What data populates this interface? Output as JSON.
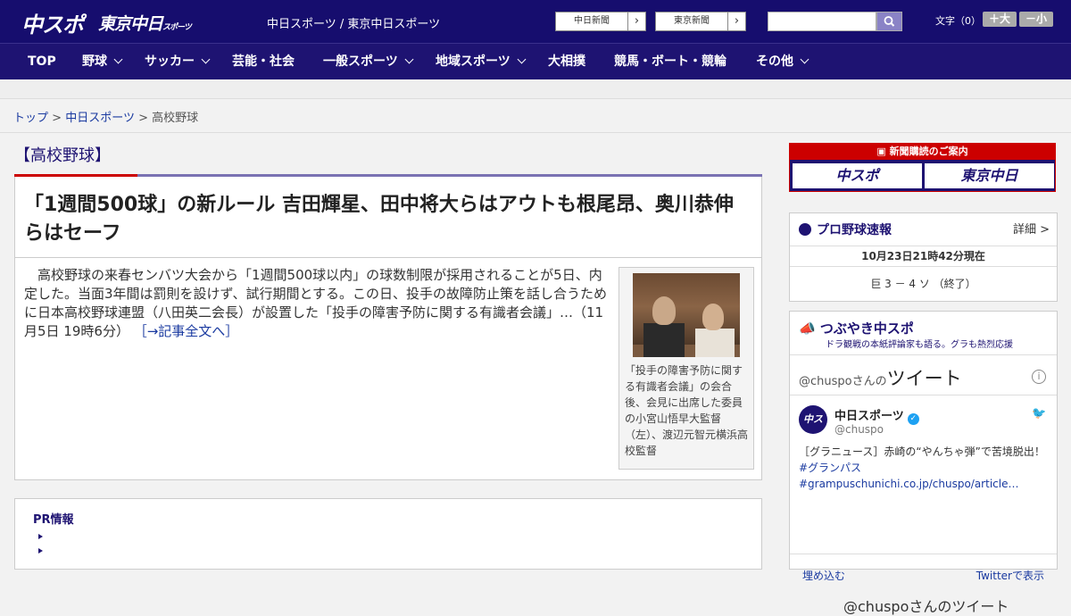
{
  "header": {
    "logo_chuspo": "中スポ",
    "logo_tokyo": "東京中日",
    "logo_tokyo_small": "スポーツ",
    "site_title": "中日スポーツ / 東京中日スポーツ",
    "paper_links": [
      {
        "label": "中日新聞"
      },
      {
        "label": "東京新聞"
      }
    ],
    "search": {
      "value": "",
      "placeholder": ""
    },
    "font_size_label": "文字（0）",
    "font_bigger": "＋大",
    "font_smaller": "－小",
    "colors": {
      "header_bg": "#160d6e",
      "accent_red": "#cc0000"
    }
  },
  "nav": {
    "items": [
      {
        "label": "TOP"
      },
      {
        "label": "野球"
      },
      {
        "label": "サッカー"
      },
      {
        "label": "芸能・社会"
      },
      {
        "label": "一般スポーツ"
      },
      {
        "label": "地域スポーツ"
      },
      {
        "label": "大相撲"
      },
      {
        "label": "競馬・ボート・競輪"
      },
      {
        "label": "その他"
      }
    ]
  },
  "breadcrumb": {
    "home": "トップ",
    "sep": ">",
    "parent": "中日スポーツ",
    "current": "高校野球"
  },
  "section": {
    "title": "【高校野球】"
  },
  "article": {
    "headline": "「1週間500球」の新ルール 吉田輝星、田中将大らはアウトも根尾昂、奥川恭伸らはセーフ",
    "lead": "高校野球の来春センバツ大会から「1週間500球以内」の球数制限が採用されることが5日、内定した。当面3年間は罰則を設けず、試行期間とする。この日、投手の故障防止策を話し合うために日本高校野球連盟（八田英二会長）が設置した「投手の障害予防に関する有識者会議」…（11月5日 19時6分）",
    "read_more": "［→記事全文へ］",
    "photo_caption": "「投手の障害予防に関する有識者会議」の会合後、会見に出席した委員の小宮山悟早大監督（左）、渡辺元智元横浜高校監督"
  },
  "pr": {
    "title": "PR情報"
  },
  "sidebar": {
    "ad": {
      "title": "新聞購読のご案内",
      "logo_left": "中スポ",
      "logo_right": "東京中日"
    },
    "baseball": {
      "title": "プロ野球速報",
      "detail": "詳細 >",
      "updated": "10月23日21時42分現在",
      "score": "巨 3 － 4 ソ （終了）"
    },
    "tweets": {
      "title": "つぶやき中スポ",
      "subtitle": "ドラ観戦の本紙評論家も語る。グラも熱烈応援",
      "handle_prefix": "@chuspoさんの",
      "tweets_word": "ツイート",
      "user_name": "中日スポーツ",
      "user_handle": "@chuspo",
      "avatar_text": "中スポ",
      "text": "［グラニュース］赤崎の“やんちゃ弾”で苦境脱出！",
      "tags": "#グランパス #grampuschunichi.co.jp/chuspo/article…",
      "embed": "埋め込む",
      "view_on_twitter": "Twitterで表示",
      "footer": "@chuspoさんのツイート"
    }
  }
}
